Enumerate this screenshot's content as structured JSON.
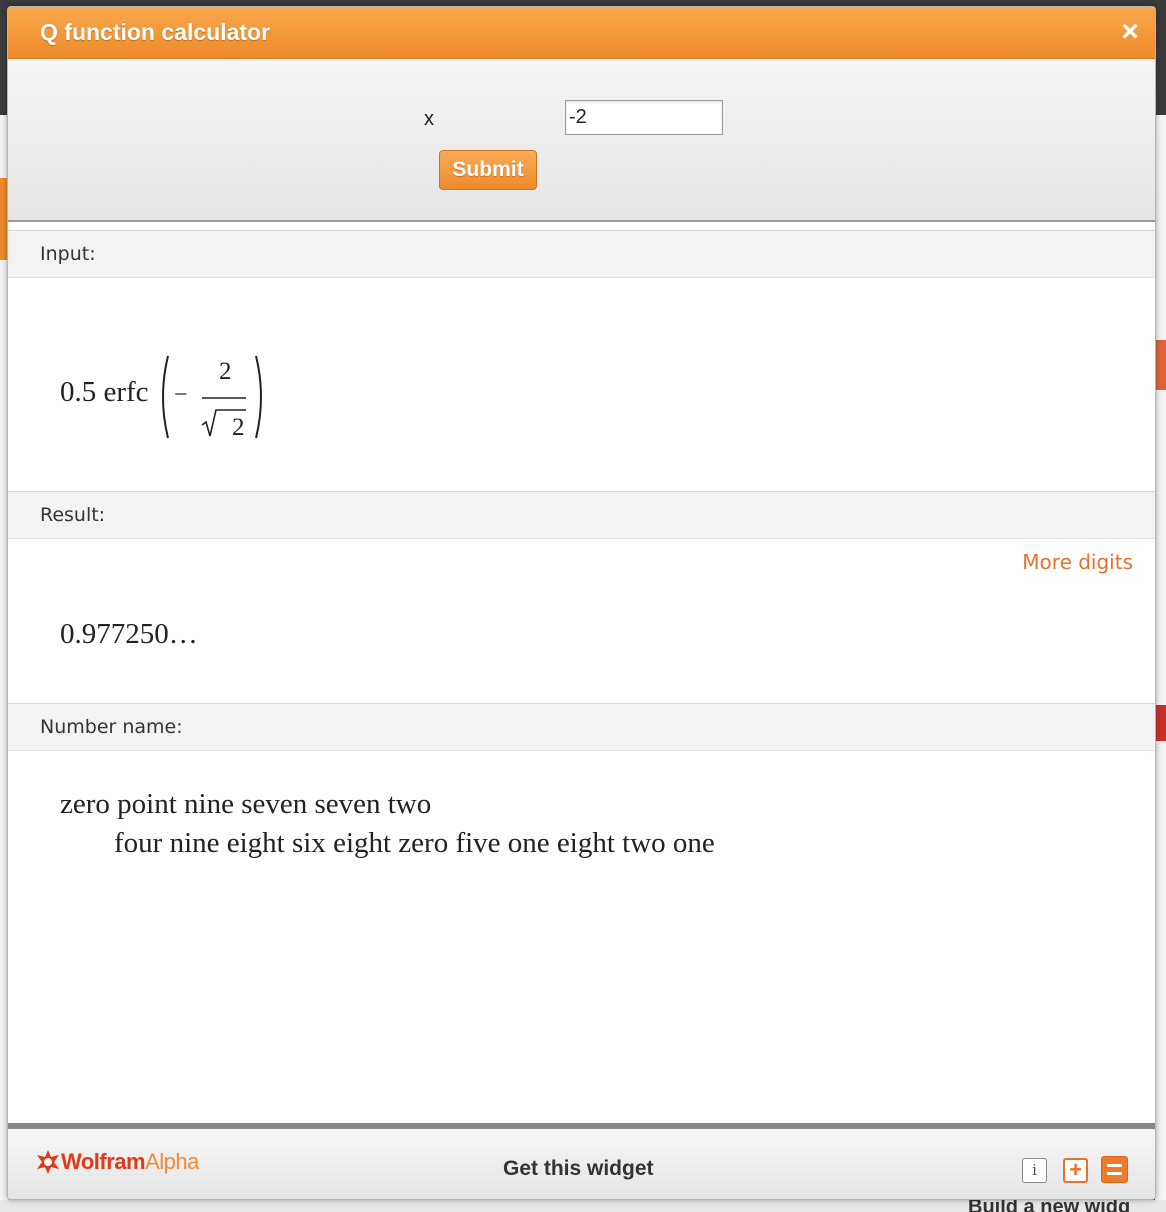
{
  "window": {
    "title": "Q function calculator",
    "close_icon": "×"
  },
  "form": {
    "variable_label": "x",
    "input_value": "-2",
    "submit_label": "Submit"
  },
  "pods": {
    "input": {
      "title": "Input:",
      "expression_prefix": "0.5 erfc",
      "numerator": "2",
      "denominator": "2",
      "minus": "−"
    },
    "result": {
      "title": "Result:",
      "more_digits_label": "More digits",
      "value": "0.977250…"
    },
    "number_name": {
      "title": "Number name:",
      "line1": "zero point nine seven seven two",
      "line2": "four nine eight six eight zero five one eight two one"
    }
  },
  "footer": {
    "logo_part1": "Wolfram",
    "logo_part2": "Alpha",
    "get_widget_label": "Get this widget",
    "info_icon": "i",
    "plus_icon": "+"
  },
  "background": {
    "partial_text": "Build a new widg"
  },
  "colors": {
    "accent_orange": "#ee8a2b",
    "link_orange": "#e8722c",
    "logo_red": "#dd3b1c"
  }
}
